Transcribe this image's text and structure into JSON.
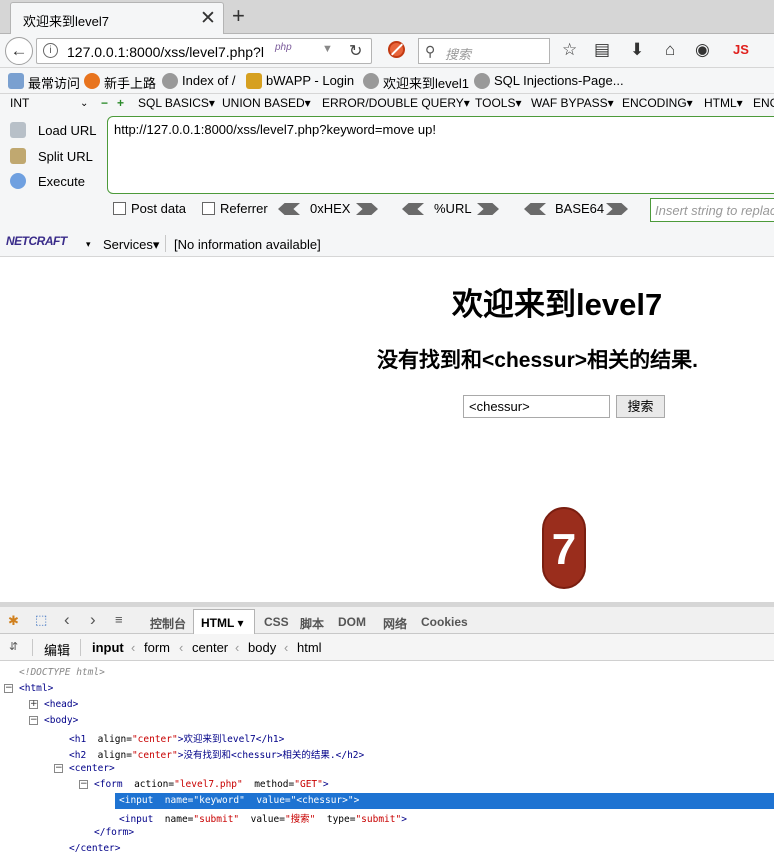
{
  "browser": {
    "tab_title": "欢迎来到level7",
    "url": "127.0.0.1:8000/xss/level7.php?l",
    "url_badge": "php",
    "search_placeholder": "搜索",
    "js_label": "JS"
  },
  "bookmarks": [
    {
      "label": "最常访问"
    },
    {
      "label": "新手上路"
    },
    {
      "label": "Index of /"
    },
    {
      "label": "bWAPP - Login"
    },
    {
      "label": "欢迎来到level1"
    },
    {
      "label": "SQL Injections-Page..."
    }
  ],
  "hackbar": {
    "menu": [
      "INT",
      "SQL BASICS▾",
      "UNION BASED▾",
      "ERROR/DOUBLE QUERY▾",
      "TOOLS▾",
      "WAF BYPASS▾",
      "ENCODING▾",
      "HTML▾",
      "ENC"
    ],
    "buttons": [
      "Load URL",
      "Split URL",
      "Execute"
    ],
    "url_value": "http://127.0.0.1:8000/xss/level7.php?keyword=move up!",
    "post_data": "Post data",
    "referrer": "Referrer",
    "hex": "0xHEX",
    "url_enc": "%URL",
    "base64": "BASE64",
    "insert_placeholder": "Insert string to replace"
  },
  "netcraft": {
    "logo": "NETCRAFT",
    "services": "Services▾",
    "info": "[No information available]"
  },
  "page": {
    "h1": "欢迎来到level7",
    "h2": "没有找到和<chessur>相关的结果.",
    "keyword_value": "<chessur>",
    "submit_label": "搜索",
    "badge": "7"
  },
  "devtools": {
    "tabs": [
      "控制台",
      "HTML ▾",
      "CSS",
      "脚本",
      "DOM",
      "网络",
      "Cookies"
    ],
    "edit_label": "编辑",
    "breadcrumbs": [
      "input",
      "form",
      "center",
      "body",
      "html"
    ],
    "tree": {
      "doctype": "<!DOCTYPE html>",
      "html": "<html>",
      "head": "<head>",
      "body": "<body>",
      "h1_open": "<h1",
      "h1_attr": "align=",
      "h1_val": "\"center\"",
      "h1_text": ">欢迎来到level7</h1>",
      "h2_open": "<h2",
      "h2_attr": "align=",
      "h2_val": "\"center\"",
      "h2_text": ">没有找到和<chessur>相关的结果.</h2>",
      "center_open": "<center>",
      "form_open": "<form",
      "form_action_attr": "action=",
      "form_action_val": "\"level7.php\"",
      "form_method_attr": "method=",
      "form_method_val": "\"GET\"",
      "form_close_bracket": ">",
      "input1_open": "<input",
      "input1_name_attr": "name=",
      "input1_name_val": "\"keyword\"",
      "input1_value_attr": "value=",
      "input1_value_val": "\"<chessur>\"",
      "input1_close": ">",
      "input2_open": "<input",
      "input2_name_attr": "name=",
      "input2_name_val": "\"submit\"",
      "input2_value_attr": "value=",
      "input2_value_val": "\"搜索\"",
      "input2_type_attr": "type=",
      "input2_type_val": "\"submit\"",
      "input2_close": ">",
      "form_close": "</form>",
      "center_close": "</center>"
    }
  },
  "colors": {
    "selection": "#1e73d2",
    "badge": "#9a2d1c",
    "hackbar_border": "#4c9a3a",
    "tag": "#000088",
    "attr_value": "#c80000"
  }
}
